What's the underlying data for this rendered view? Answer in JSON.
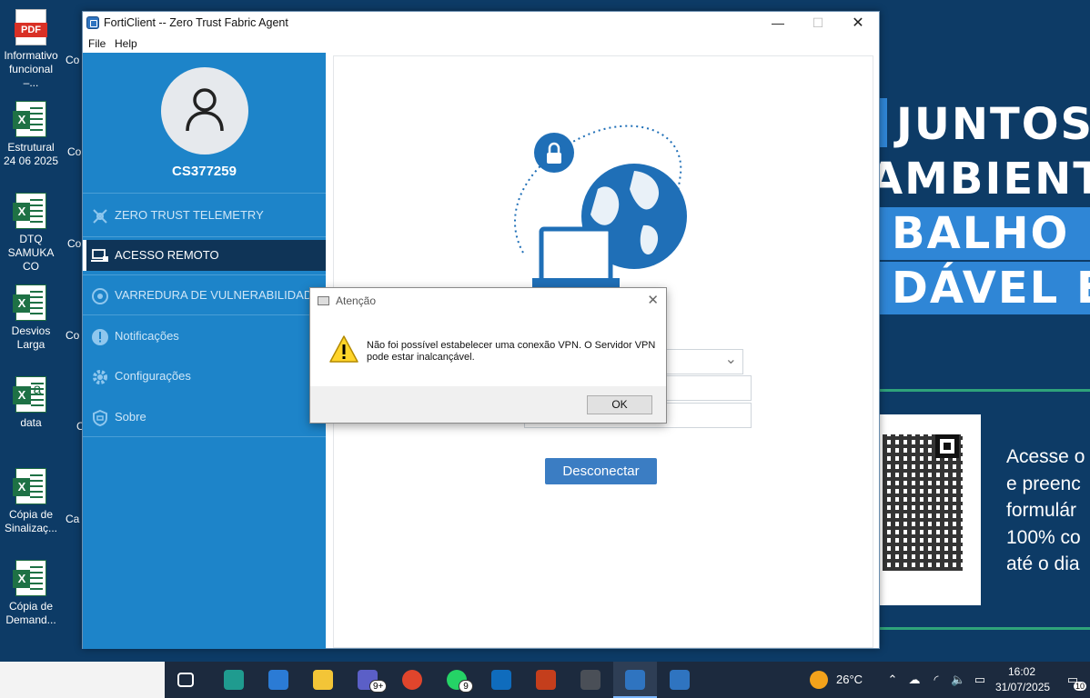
{
  "wallpaper": {
    "banner": [
      "JUNTOS P",
      "AMBIENTE",
      "BALHO MA",
      "DÁVEL E SE"
    ],
    "side_text": [
      "Acesse o",
      "e preenc",
      "formulár",
      "100% co",
      "até o dia"
    ]
  },
  "desktop_icons": [
    {
      "label": "Informativo funcional –...",
      "type": "pdf"
    },
    {
      "label": "Estrutural 24 06 2025",
      "type": "xl"
    },
    {
      "label": "DTQ SAMUKA CO",
      "type": "xl"
    },
    {
      "label": "Desvios Larga",
      "type": "xl"
    },
    {
      "label": "data",
      "type": "csv"
    },
    {
      "label": "Cópia de Sinalizaç...",
      "type": "xl"
    },
    {
      "label": "Cópia de Demand...",
      "type": "xl"
    }
  ],
  "desktop_partial": [
    "Co",
    "Co de",
    "Co pl",
    "Co dos",
    "C",
    "Ca",
    ""
  ],
  "window": {
    "title": "FortiClient -- Zero Trust Fabric Agent",
    "minimize": "—",
    "maximize": "☐",
    "close": "✕",
    "menu": [
      "File",
      "Help"
    ]
  },
  "sidebar": {
    "user": "CS377259",
    "items": [
      {
        "label": "ZERO TRUST TELEMETRY",
        "icon": "telemetry-icon"
      },
      {
        "label": "ACESSO REMOTO",
        "icon": "remote-access-icon",
        "active": true
      },
      {
        "label": "VARREDURA DE VULNERABILIDADE",
        "icon": "vulnerability-scan-icon"
      },
      {
        "label": "Notificações",
        "icon": "alert-icon"
      },
      {
        "label": "Configurações",
        "icon": "gear-icon"
      },
      {
        "label": "Sobre",
        "icon": "shield-icon"
      }
    ]
  },
  "content": {
    "disconnect_label": "Desconectar"
  },
  "dialog": {
    "title": "Atenção",
    "message": "Não foi possível estabelecer uma conexão VPN. O Servidor VPN pode estar inalcançável.",
    "ok_label": "OK"
  },
  "taskbar": {
    "apps": [
      {
        "name": "task-view",
        "color": "#1c2a3e"
      },
      {
        "name": "edge",
        "color": "#1f9b8f"
      },
      {
        "name": "store",
        "color": "#2b7bd5"
      },
      {
        "name": "file-explorer",
        "color": "#f3c537"
      },
      {
        "name": "teams",
        "color": "#5b5fc7",
        "badge": "9+"
      },
      {
        "name": "chrome",
        "color": "#e0452c"
      },
      {
        "name": "whatsapp",
        "color": "#25d366",
        "badge": "9"
      },
      {
        "name": "outlook",
        "color": "#0f6cbd"
      },
      {
        "name": "powerpoint",
        "color": "#c43e1c"
      },
      {
        "name": "calculator",
        "color": "#4a4f57"
      },
      {
        "name": "forticlient",
        "color": "#2f74c0",
        "active": true
      },
      {
        "name": "forticlient-2",
        "color": "#2f74c0"
      }
    ],
    "weather": "26°C",
    "time": "16:02",
    "date": "31/07/2025",
    "notifications": "10"
  }
}
